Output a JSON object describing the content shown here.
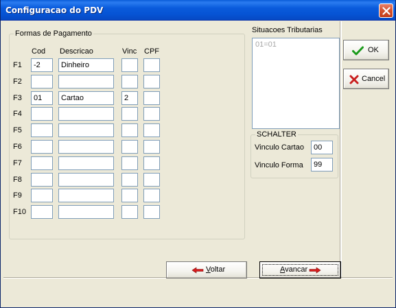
{
  "window": {
    "title": "Configuracao do PDV"
  },
  "payment_group": {
    "title": "Formas de Pagamento",
    "headers": {
      "cod": "Cod",
      "descricao": "Descricao",
      "vinc": "Vinc",
      "cpf": "CPF"
    },
    "rows": [
      {
        "key": "F1",
        "cod": "-2",
        "descricao": "Dinheiro",
        "vinc": "",
        "cpf": ""
      },
      {
        "key": "F2",
        "cod": "",
        "descricao": "",
        "vinc": "",
        "cpf": ""
      },
      {
        "key": "F3",
        "cod": "01",
        "descricao": "Cartao",
        "vinc": "2",
        "cpf": ""
      },
      {
        "key": "F4",
        "cod": "",
        "descricao": "",
        "vinc": "",
        "cpf": ""
      },
      {
        "key": "F5",
        "cod": "",
        "descricao": "",
        "vinc": "",
        "cpf": ""
      },
      {
        "key": "F6",
        "cod": "",
        "descricao": "",
        "vinc": "",
        "cpf": ""
      },
      {
        "key": "F7",
        "cod": "",
        "descricao": "",
        "vinc": "",
        "cpf": ""
      },
      {
        "key": "F8",
        "cod": "",
        "descricao": "",
        "vinc": "",
        "cpf": ""
      },
      {
        "key": "F9",
        "cod": "",
        "descricao": "",
        "vinc": "",
        "cpf": ""
      },
      {
        "key": "F10",
        "cod": "",
        "descricao": "",
        "vinc": "",
        "cpf": ""
      }
    ]
  },
  "tributarias": {
    "label": "Situacoes Tributarias",
    "items": [
      "01=01"
    ]
  },
  "schalter": {
    "title": "SCHALTER",
    "vinculo_cartao_label": "Vinculo Cartao",
    "vinculo_cartao_value": "00",
    "vinculo_forma_label": "Vinculo Forma",
    "vinculo_forma_value": "99"
  },
  "buttons": {
    "ok": "OK",
    "cancel": "Cancel",
    "voltar_first": "V",
    "voltar_rest": "oltar",
    "avancar_first": "A",
    "avancar_rest": "vancar"
  },
  "icons": {
    "ok": "check-icon",
    "cancel": "x-icon",
    "voltar": "arrow-left-icon",
    "avancar": "arrow-right-icon",
    "close": "close-icon"
  },
  "colors": {
    "titlebar": "#0a5bdc",
    "check": "#1a9a1a",
    "cancel_x": "#c81e1e",
    "arrow": "#d81c1c"
  }
}
